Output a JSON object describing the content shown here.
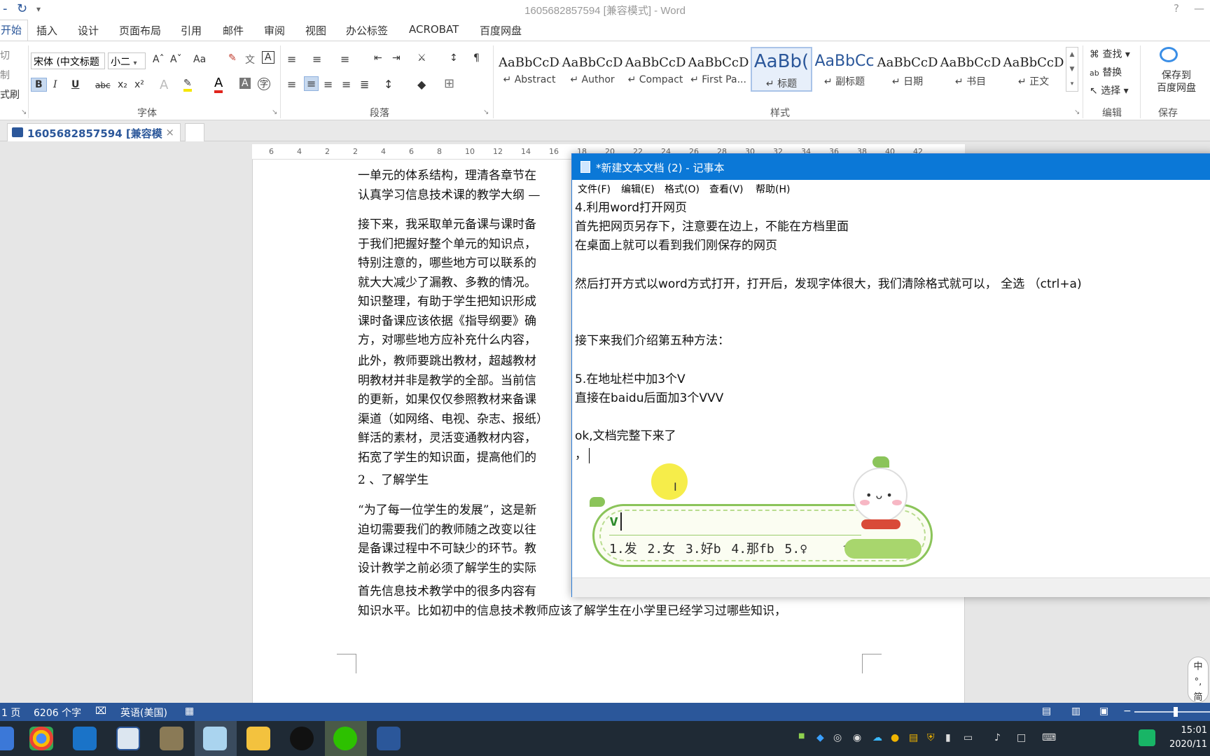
{
  "window": {
    "title": "1605682857594 [兼容模式] - Word",
    "help": "?",
    "minimize": "—"
  },
  "ribbon_tabs": [
    "开始",
    "插入",
    "设计",
    "页面布局",
    "引用",
    "邮件",
    "审阅",
    "视图",
    "办公标签",
    "ACROBAT",
    "百度网盘"
  ],
  "clipboard": {
    "cut": "切",
    "copy": "制",
    "format_painter": "式刷"
  },
  "font": {
    "name": "宋体 (中文标题",
    "size": "小二",
    "grow": "Aˆ",
    "shrink": "Aˇ",
    "case": "Aa",
    "bold": "B",
    "italic": "I",
    "underline": "U",
    "strike": "abc",
    "subscript": "x₂",
    "superscript": "x²",
    "group_label": "字体"
  },
  "paragraph": {
    "group_label": "段落"
  },
  "styles": {
    "group_label": "样式",
    "items": [
      {
        "preview": "AaBbCcDd",
        "name": "↵ Abstract"
      },
      {
        "preview": "AaBbCcD",
        "name": "↵ Author"
      },
      {
        "preview": "AaBbCcD",
        "name": "↵ Compact"
      },
      {
        "preview": "AaBbCcD",
        "name": "↵ First Pa..."
      },
      {
        "preview": "AaBb(",
        "name": "↵ 标题"
      },
      {
        "preview": "AaBbCc",
        "name": "↵ 副标题"
      },
      {
        "preview": "AaBbCcD",
        "name": "↵ 日期"
      },
      {
        "preview": "AaBbCcD",
        "name": "↵ 书目"
      },
      {
        "preview": "AaBbCcD",
        "name": "↵ 正文"
      }
    ]
  },
  "editing": {
    "group_label": "编辑",
    "find": "查找",
    "replace": "替换",
    "select": "选择"
  },
  "save": {
    "group_label": "保存",
    "button": "保存到\n百度网盘"
  },
  "doc_tab": {
    "label": "1605682857594 [兼容模式]",
    "close": "×"
  },
  "ruler_ticks": [
    "6",
    "4",
    "2",
    "2",
    "4",
    "6",
    "8",
    "10",
    "12",
    "14",
    "16",
    "18",
    "20",
    "22",
    "24",
    "26",
    "28",
    "30",
    "32",
    "34",
    "36",
    "38",
    "40",
    "42"
  ],
  "document": {
    "paragraphs": [
      [
        "一单元的体系结构，理清各章节在",
        "认真学习信息技术课的教学大纲 —"
      ],
      [
        "接下来，我采取单元备课与课时备",
        "于我们把握好整个单元的知识点，",
        "特别注意的，哪些地方可以联系的",
        "就大大减少了漏教、多教的情况。",
        "知识整理，有助于学生把知识形成",
        "课时备课应该依据《指导纲要》确",
        "方，对哪些地方应补充什么内容，"
      ],
      [
        "此外，教师要跳出教材，超越教材",
        "明教材并非是教学的全部。当前信",
        "的更新，如果仅仅参照教材来备课",
        "渠道（如网络、电视、杂志、报纸）",
        "鲜活的素材，灵活变通教材内容，",
        "拓宽了学生的知识面，提高他们的"
      ],
      [
        "2 、了解学生"
      ],
      [
        "“为了每一位学生的发展”，这是新",
        "迫切需要我们的教师随之改变以往",
        "是备课过程中不可缺少的环节。教",
        "设计教学之前必须了解学生的实际"
      ],
      [
        "首先信息技术教学中的很多内容有",
        "知识水平。比如初中的信息技术教师应该了解学生在小学里已经学习过哪些知识，"
      ]
    ]
  },
  "statusbar": {
    "page": "1 页",
    "words": "6206 个字",
    "language": "英语(美国)"
  },
  "notepad": {
    "title": "*新建文本文档 (2) - 记事本",
    "menu": [
      "文件(F)",
      "编辑(E)",
      "格式(O)",
      "查看(V)",
      "帮助(H)"
    ],
    "lines": [
      "4.利用word打开网页",
      "首先把网页另存下，注意要在边上，不能在方档里面",
      "在桌面上就可以看到我们刚保存的网页",
      "",
      "然后打开方式以word方式打开，打开后，发现字体很大，我们清除格式就可以， 全选 （ctrl+a)",
      "",
      "",
      "接下来我们介绍第五种方法：",
      "",
      "5.在地址栏中加3个V",
      "直接在baidu后面加3个VVV",
      "",
      "ok,文档完整下来了",
      "，"
    ]
  },
  "ime": {
    "composition": "v",
    "candidates": "1.发  2.女  3.好b  4.那fb  5.♀",
    "mode": "中\n°,\n简"
  },
  "taskbar": {
    "time": "15:01",
    "date": "2020/11"
  }
}
